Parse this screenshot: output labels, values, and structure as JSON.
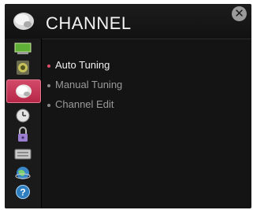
{
  "header": {
    "title": "CHANNEL",
    "close_glyph": "✕"
  },
  "sidebar": {
    "items": [
      {
        "icon": "picture-icon"
      },
      {
        "icon": "sound-icon"
      },
      {
        "icon": "channel-dish-icon",
        "active": true
      },
      {
        "icon": "clock-icon"
      },
      {
        "icon": "lock-icon"
      },
      {
        "icon": "keyboard-icon"
      },
      {
        "icon": "network-globe-icon"
      },
      {
        "icon": "help-icon"
      }
    ]
  },
  "menu": {
    "items": [
      {
        "label": "Auto Tuning",
        "selected": true
      },
      {
        "label": "Manual Tuning",
        "selected": false
      },
      {
        "label": "Channel Edit",
        "selected": false
      }
    ]
  },
  "colors": {
    "accent": "#c7365a",
    "background": "#141414"
  }
}
